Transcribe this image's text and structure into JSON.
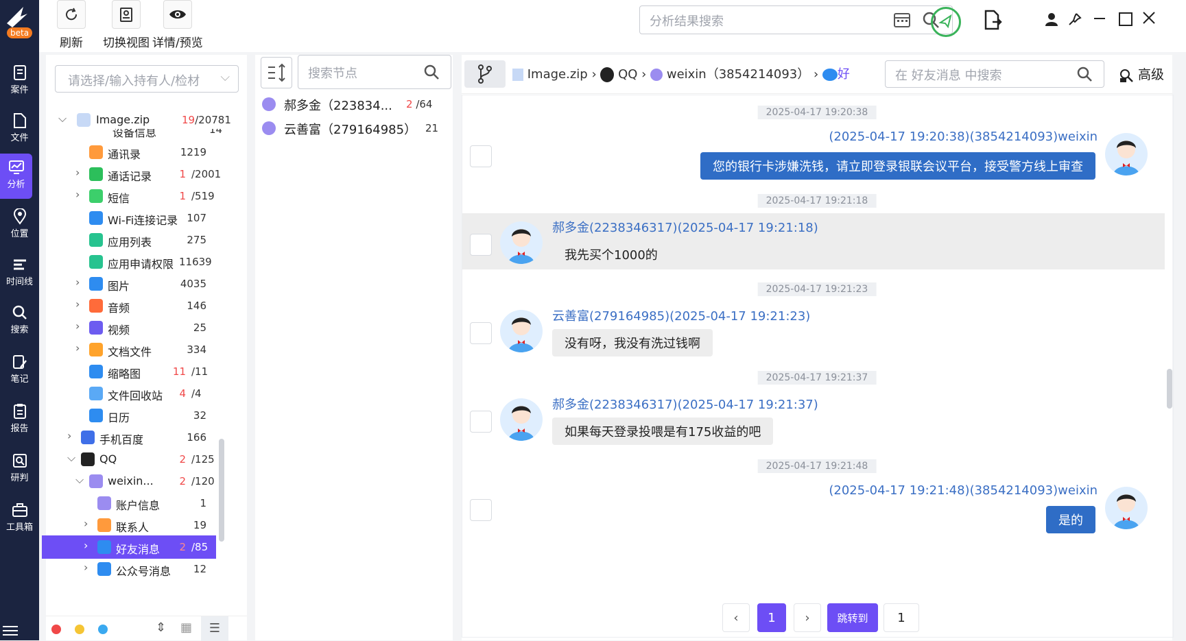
{
  "nav": {
    "logo_badge": "beta",
    "items": [
      {
        "label": "案件",
        "icon": "case-icon"
      },
      {
        "label": "文件",
        "icon": "file-icon"
      },
      {
        "label": "分析",
        "icon": "analysis-icon",
        "active": true
      },
      {
        "label": "位置",
        "icon": "location-icon"
      },
      {
        "label": "时间线",
        "icon": "timeline-icon"
      },
      {
        "label": "搜索",
        "icon": "search-icon"
      },
      {
        "label": "笔记",
        "icon": "note-icon"
      },
      {
        "label": "报告",
        "icon": "report-icon"
      },
      {
        "label": "研判",
        "icon": "judge-icon"
      },
      {
        "label": "工具箱",
        "icon": "toolbox-icon"
      }
    ]
  },
  "toolbar": {
    "refresh_label": "刷新",
    "switch_view_label": "切换视图",
    "detail_preview_label": "详情/预览",
    "result_search_placeholder": "分析结果搜索"
  },
  "tree": {
    "owner_placeholder": "请选择/输入持有人/检材",
    "root": {
      "label": "Image.zip",
      "count_hit": "19",
      "count_total": "/20781"
    },
    "partial_top": {
      "label": "设备信息",
      "count": "14"
    },
    "rows": [
      {
        "label": "通讯录",
        "count": "1219",
        "icon_color": "#ff9a3c"
      },
      {
        "label": "通话记录",
        "hit": "1",
        "count": "/2001",
        "icon_color": "#2cbf5b"
      },
      {
        "label": "短信",
        "hit": "1",
        "count": "/519",
        "icon_color": "#3ccf6b"
      },
      {
        "label": "Wi-Fi连接记录",
        "count": "107",
        "icon_color": "#2e8cf0"
      },
      {
        "label": "应用列表",
        "count": "275",
        "icon_color": "#27c38f"
      },
      {
        "label": "应用申请权限",
        "count": "11639",
        "icon_color": "#27c38f"
      },
      {
        "label": "图片",
        "count": "4035",
        "icon_color": "#2e8cf0"
      },
      {
        "label": "音频",
        "count": "146",
        "icon_color": "#ff6b3a"
      },
      {
        "label": "视频",
        "count": "25",
        "icon_color": "#6d5cf0"
      },
      {
        "label": "文档文件",
        "count": "334",
        "icon_color": "#ffa32b"
      },
      {
        "label": "缩略图",
        "hit": "11",
        "count": "/11",
        "icon_color": "#2e8cf0"
      },
      {
        "label": "文件回收站",
        "hit": "4",
        "count": "/4",
        "icon_color": "#5aa9f5"
      },
      {
        "label": "日历",
        "count": "32",
        "icon_color": "#2e8cf0"
      },
      {
        "label": "手机百度",
        "count": "166",
        "icon_color": "#3f6fe8"
      },
      {
        "label": "QQ",
        "hit": "2",
        "count": "/125",
        "icon_color": "#222"
      },
      {
        "label": "weixin...",
        "hit": "2",
        "count": "/120",
        "icon_color": "#9b8cf0"
      },
      {
        "label": "账户信息",
        "count": "1",
        "icon_color": "#9b8cf0"
      },
      {
        "label": "联系人",
        "count": "19",
        "icon_color": "#ff9a3c"
      },
      {
        "label": "好友消息",
        "hit": "2",
        "count": "/85",
        "icon_color": "#2e8cf0"
      },
      {
        "label": "公众号消息",
        "count": "12",
        "icon_color": "#2e8cf0"
      }
    ]
  },
  "nodes": {
    "search_placeholder": "搜索节点",
    "items": [
      {
        "label": "郝多金（223834...",
        "hit": "2",
        "count": "/64"
      },
      {
        "label": "云善富（279164985）",
        "count": "21"
      }
    ]
  },
  "chat": {
    "breadcrumb": [
      "Image.zip",
      "QQ",
      "weixin（3854214093）",
      "好"
    ],
    "search_placeholder": "在 好友消息 中搜索",
    "advanced_label": "高级",
    "messages": [
      {
        "time": "2025-04-17 19:20:38",
        "sender": "(2025-04-17 19:20:38)(3854214093)weixin",
        "text": "您的银行卡涉嫌洗钱，请立即登录银联会议平台，接受警方线上审查",
        "side": "me"
      },
      {
        "time": "2025-04-17 19:21:18",
        "sender": "郝多金(2238346317)(2025-04-17 19:21:18)",
        "text": "我先买个1000的",
        "side": "them"
      },
      {
        "time": "2025-04-17 19:21:23",
        "sender": "云善富(279164985)(2025-04-17 19:21:23)",
        "text": "没有呀，我没有洗过钱啊",
        "side": "them"
      },
      {
        "time": "2025-04-17 19:21:37",
        "sender": "郝多金(2238346317)(2025-04-17 19:21:37)",
        "text": "如果每天登录投喂是有175收益的吧",
        "side": "them"
      },
      {
        "time": "2025-04-17 19:21:48",
        "sender": "(2025-04-17 19:21:48)(3854214093)weixin",
        "text": "是的",
        "side": "me"
      }
    ],
    "pagination": {
      "current": "1",
      "jump_label": "跳转到",
      "jump_value": "1"
    }
  }
}
